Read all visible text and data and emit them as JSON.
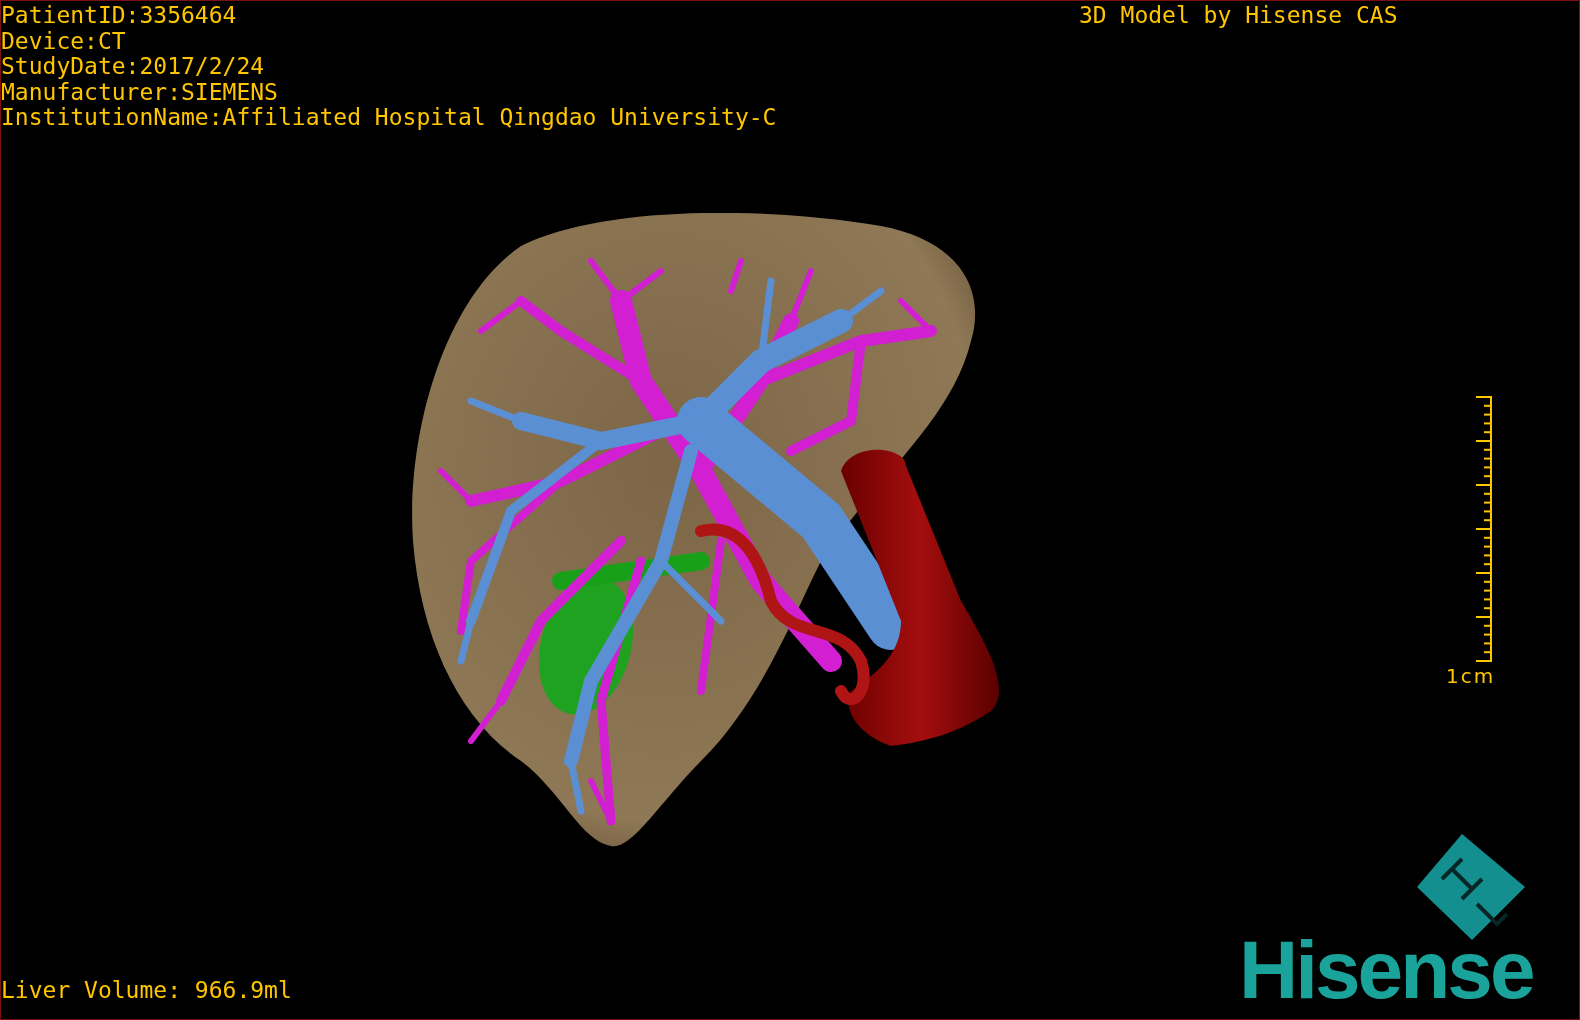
{
  "patient_info": [
    "PatientID:3356464",
    "Device:CT",
    "StudyDate:2017/2/24",
    "Manufacturer:SIEMENS",
    "InstitutionName:Affiliated Hospital Qingdao University-C"
  ],
  "title": "3D Model by Hisense CAS",
  "scale_label": "1cm",
  "liver_volume": "Liver Volume: 966.9ml",
  "logo_text": "Hisense"
}
